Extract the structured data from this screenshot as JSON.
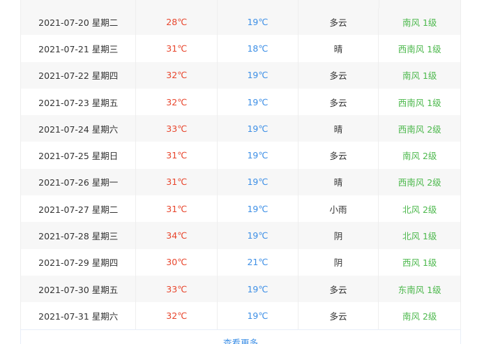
{
  "weather_table": {
    "rows": [
      {
        "date": "2021-07-20 星期二",
        "high": "28℃",
        "low": "19℃",
        "weather": "多云",
        "wind": "南风 1级"
      },
      {
        "date": "2021-07-21 星期三",
        "high": "31℃",
        "low": "18℃",
        "weather": "晴",
        "wind": "西南风 1级"
      },
      {
        "date": "2021-07-22 星期四",
        "high": "32℃",
        "low": "19℃",
        "weather": "多云",
        "wind": "南风 1级"
      },
      {
        "date": "2021-07-23 星期五",
        "high": "32℃",
        "low": "19℃",
        "weather": "多云",
        "wind": "西南风 1级"
      },
      {
        "date": "2021-07-24 星期六",
        "high": "33℃",
        "low": "19℃",
        "weather": "晴",
        "wind": "西南风 2级"
      },
      {
        "date": "2021-07-25 星期日",
        "high": "31℃",
        "low": "19℃",
        "weather": "多云",
        "wind": "南风 2级"
      },
      {
        "date": "2021-07-26 星期一",
        "high": "31℃",
        "low": "19℃",
        "weather": "晴",
        "wind": "西南风 2级"
      },
      {
        "date": "2021-07-27 星期二",
        "high": "31℃",
        "low": "19℃",
        "weather": "小雨",
        "wind": "北风 2级"
      },
      {
        "date": "2021-07-28 星期三",
        "high": "34℃",
        "low": "19℃",
        "weather": "阴",
        "wind": "北风 1级"
      },
      {
        "date": "2021-07-29 星期四",
        "high": "30℃",
        "low": "21℃",
        "weather": "阴",
        "wind": "西风 1级"
      },
      {
        "date": "2021-07-30 星期五",
        "high": "33℃",
        "low": "19℃",
        "weather": "多云",
        "wind": "东南风 1级"
      },
      {
        "date": "2021-07-31 星期六",
        "high": "32℃",
        "low": "19℃",
        "weather": "多云",
        "wind": "南风 2级"
      }
    ]
  },
  "more_link": "查看更多",
  "colors": {
    "high_temp": "#e8452c",
    "low_temp": "#3d8fe6",
    "wind": "#4cb84c",
    "text": "#333333",
    "row_alt": "#f7f7f7"
  }
}
